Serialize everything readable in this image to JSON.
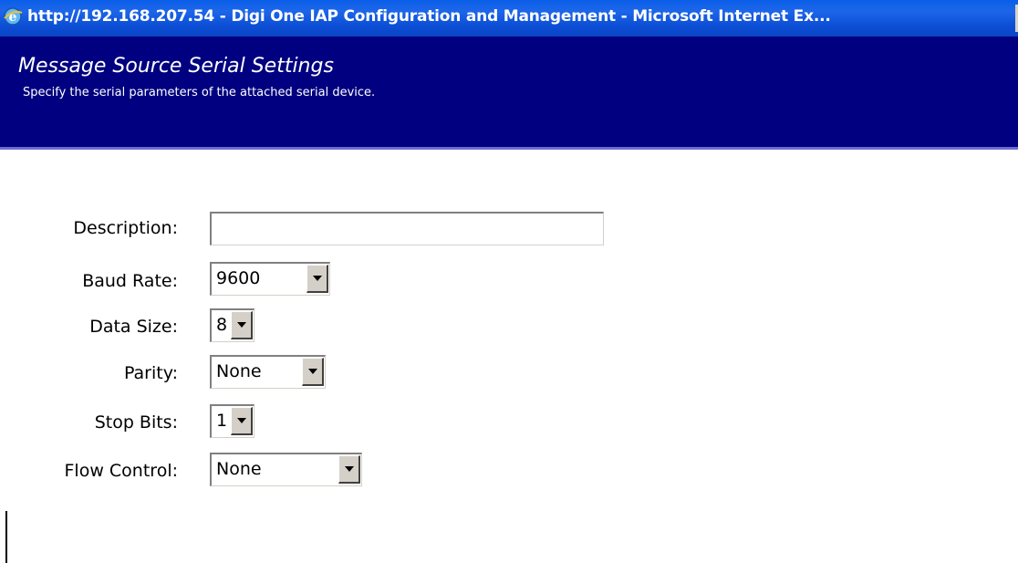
{
  "window": {
    "title": "http://192.168.207.54 - Digi One IAP Configuration and Management - Microsoft Internet Ex..."
  },
  "header": {
    "title": "Message Source Serial Settings",
    "subtitle": "Specify the serial parameters of the attached serial device."
  },
  "form": {
    "description": {
      "label": "Description:",
      "value": "",
      "placeholder": ""
    },
    "baud_rate": {
      "label": "Baud Rate:",
      "value": "9600"
    },
    "data_size": {
      "label": "Data Size:",
      "value": "8"
    },
    "parity": {
      "label": "Parity:",
      "value": "None"
    },
    "stop_bits": {
      "label": "Stop Bits:",
      "value": "1"
    },
    "flow_control": {
      "label": "Flow Control:",
      "value": "None"
    }
  },
  "icons": {
    "browser": "internet-explorer-icon",
    "dropdown": "chevron-down-icon"
  },
  "colors": {
    "titlebar": "#0a5ee8",
    "header_band": "#000080",
    "button_face": "#d4d0c8"
  }
}
